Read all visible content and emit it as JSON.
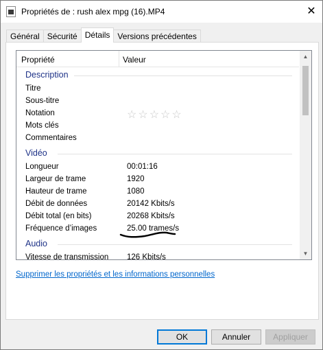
{
  "window": {
    "title": "Propriétés de : rush alex mpg (16).MP4",
    "close_glyph": "✕"
  },
  "tabs": [
    {
      "label": "Général"
    },
    {
      "label": "Sécurité"
    },
    {
      "label": "Détails",
      "active": true
    },
    {
      "label": "Versions précédentes"
    }
  ],
  "table": {
    "col_property": "Propriété",
    "col_value": "Valeur",
    "groups": {
      "description": "Description",
      "video": "Vidéo",
      "audio": "Audio"
    },
    "description_rows": [
      {
        "name": "Titre",
        "value": ""
      },
      {
        "name": "Sous-titre",
        "value": ""
      },
      {
        "name": "Notation",
        "value": ""
      },
      {
        "name": "Mots clés",
        "value": ""
      },
      {
        "name": "Commentaires",
        "value": ""
      }
    ],
    "rating": {
      "max": 5,
      "value": 0
    },
    "video_rows": [
      {
        "name": "Longueur",
        "value": "00:01:16"
      },
      {
        "name": "Largeur de trame",
        "value": "1920"
      },
      {
        "name": "Hauteur de trame",
        "value": "1080"
      },
      {
        "name": "Débit de données",
        "value": "20142 Kbits/s"
      },
      {
        "name": "Débit total (en bits)",
        "value": "20268 Kbits/s"
      },
      {
        "name": "Fréquence d’images",
        "value": "25.00 trames/s"
      }
    ],
    "audio_rows": [
      {
        "name": "Vitesse de transmission",
        "value": "126 Kbits/s"
      }
    ]
  },
  "link_text": "Supprimer les propriétés et les informations personnelles",
  "buttons": {
    "ok": "OK",
    "cancel": "Annuler",
    "apply": "Appliquer"
  },
  "colors": {
    "group_heading": "#1e3287",
    "link": "#0066cc",
    "default_button_border": "#0078d7"
  }
}
